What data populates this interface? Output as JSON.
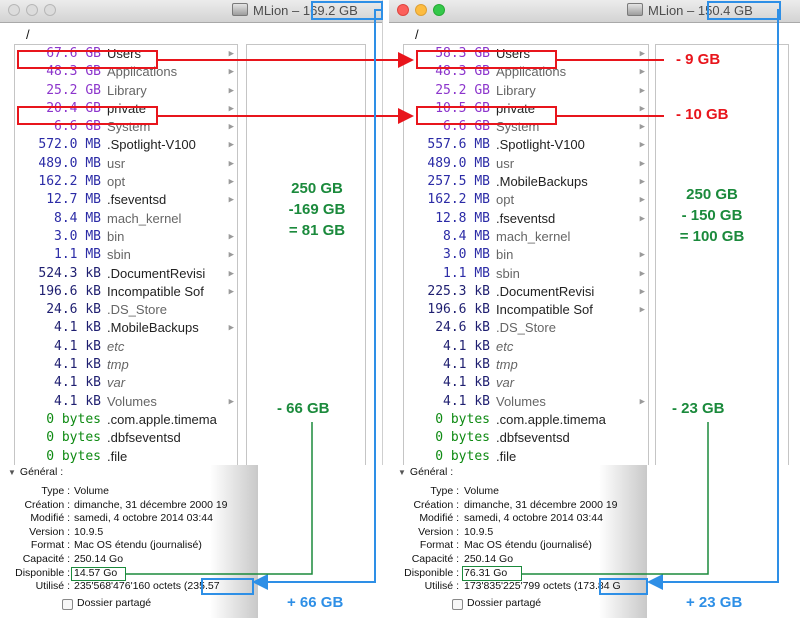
{
  "left_window": {
    "title": "MLion –",
    "title_size": "169.2 GB",
    "path": "/",
    "rows": [
      {
        "size": "67.6 GB",
        "name": "Users",
        "kind": "gb",
        "style": "normal",
        "folder": true
      },
      {
        "size": "48.3 GB",
        "name": "Applications",
        "kind": "gb",
        "style": "dim",
        "folder": true
      },
      {
        "size": "25.2 GB",
        "name": "Library",
        "kind": "gb",
        "style": "dim",
        "folder": true
      },
      {
        "size": "20.4 GB",
        "name": "private",
        "kind": "gb",
        "style": "normal",
        "folder": true
      },
      {
        "size": "6.6 GB",
        "name": "System",
        "kind": "gb",
        "style": "dim",
        "folder": true
      },
      {
        "size": "572.0 MB",
        "name": ".Spotlight-V100",
        "kind": "mb",
        "style": "normal",
        "folder": true
      },
      {
        "size": "489.0 MB",
        "name": "usr",
        "kind": "mb",
        "style": "dim",
        "folder": true
      },
      {
        "size": "162.2 MB",
        "name": "opt",
        "kind": "mb",
        "style": "dim",
        "folder": true
      },
      {
        "size": "12.7 MB",
        "name": ".fseventsd",
        "kind": "mb",
        "style": "normal",
        "folder": true
      },
      {
        "size": "8.4 MB",
        "name": "mach_kernel",
        "kind": "mb",
        "style": "dim",
        "folder": false
      },
      {
        "size": "3.0 MB",
        "name": "bin",
        "kind": "mb",
        "style": "dim",
        "folder": true
      },
      {
        "size": "1.1 MB",
        "name": "sbin",
        "kind": "mb",
        "style": "dim",
        "folder": true
      },
      {
        "size": "524.3 kB",
        "name": ".DocumentRevisi",
        "kind": "kb",
        "style": "normal",
        "folder": true
      },
      {
        "size": "196.6 kB",
        "name": "Incompatible Sof",
        "kind": "kb",
        "style": "normal",
        "folder": true
      },
      {
        "size": "24.6 kB",
        "name": ".DS_Store",
        "kind": "kb",
        "style": "dim",
        "folder": false
      },
      {
        "size": "4.1 kB",
        "name": ".MobileBackups",
        "kind": "kb",
        "style": "normal",
        "folder": true
      },
      {
        "size": "4.1 kB",
        "name": "etc",
        "kind": "kb",
        "style": "it",
        "folder": false
      },
      {
        "size": "4.1 kB",
        "name": "tmp",
        "kind": "kb",
        "style": "it",
        "folder": false
      },
      {
        "size": "4.1 kB",
        "name": "var",
        "kind": "kb",
        "style": "it",
        "folder": false
      },
      {
        "size": "4.1 kB",
        "name": "Volumes",
        "kind": "kb",
        "style": "dim",
        "folder": true
      },
      {
        "size": "0 bytes",
        "name": ".com.apple.timema",
        "kind": "b",
        "style": "normal",
        "folder": false
      },
      {
        "size": "0 bytes",
        "name": ".dbfseventsd",
        "kind": "b",
        "style": "normal",
        "folder": false
      },
      {
        "size": "0 bytes",
        "name": ".file",
        "kind": "b",
        "style": "normal",
        "folder": false
      }
    ]
  },
  "right_window": {
    "title": "MLion –",
    "title_size": "150.4 GB",
    "path": "/",
    "rows": [
      {
        "size": "58.3 GB",
        "name": "Users",
        "kind": "gb",
        "style": "normal",
        "folder": true
      },
      {
        "size": "48.3 GB",
        "name": "Applications",
        "kind": "gb",
        "style": "dim",
        "folder": true
      },
      {
        "size": "25.2 GB",
        "name": "Library",
        "kind": "gb",
        "style": "dim",
        "folder": true
      },
      {
        "size": "10.5 GB",
        "name": "private",
        "kind": "gb",
        "style": "normal",
        "folder": true
      },
      {
        "size": "6.6 GB",
        "name": "System",
        "kind": "gb",
        "style": "dim",
        "folder": true
      },
      {
        "size": "557.6 MB",
        "name": ".Spotlight-V100",
        "kind": "mb",
        "style": "normal",
        "folder": true
      },
      {
        "size": "489.0 MB",
        "name": "usr",
        "kind": "mb",
        "style": "dim",
        "folder": true
      },
      {
        "size": "257.5 MB",
        "name": ".MobileBackups",
        "kind": "mb",
        "style": "normal",
        "folder": true
      },
      {
        "size": "162.2 MB",
        "name": "opt",
        "kind": "mb",
        "style": "dim",
        "folder": true
      },
      {
        "size": "12.8 MB",
        "name": ".fseventsd",
        "kind": "mb",
        "style": "normal",
        "folder": true
      },
      {
        "size": "8.4 MB",
        "name": "mach_kernel",
        "kind": "mb",
        "style": "dim",
        "folder": false
      },
      {
        "size": "3.0 MB",
        "name": "bin",
        "kind": "mb",
        "style": "dim",
        "folder": true
      },
      {
        "size": "1.1 MB",
        "name": "sbin",
        "kind": "mb",
        "style": "dim",
        "folder": true
      },
      {
        "size": "225.3 kB",
        "name": ".DocumentRevisi",
        "kind": "kb",
        "style": "normal",
        "folder": true
      },
      {
        "size": "196.6 kB",
        "name": "Incompatible Sof",
        "kind": "kb",
        "style": "normal",
        "folder": true
      },
      {
        "size": "24.6 kB",
        "name": ".DS_Store",
        "kind": "kb",
        "style": "dim",
        "folder": false
      },
      {
        "size": "4.1 kB",
        "name": "etc",
        "kind": "kb",
        "style": "it",
        "folder": false
      },
      {
        "size": "4.1 kB",
        "name": "tmp",
        "kind": "kb",
        "style": "it",
        "folder": false
      },
      {
        "size": "4.1 kB",
        "name": "var",
        "kind": "kb",
        "style": "it",
        "folder": false
      },
      {
        "size": "4.1 kB",
        "name": "Volumes",
        "kind": "kb",
        "style": "dim",
        "folder": true
      },
      {
        "size": "0 bytes",
        "name": ".com.apple.timema",
        "kind": "b",
        "style": "normal",
        "folder": false
      },
      {
        "size": "0 bytes",
        "name": ".dbfseventsd",
        "kind": "b",
        "style": "normal",
        "folder": false
      },
      {
        "size": "0 bytes",
        "name": ".file",
        "kind": "b",
        "style": "normal",
        "folder": false
      }
    ]
  },
  "left_info": {
    "header": "Général :",
    "rows": [
      {
        "label": "Type :",
        "value": "Volume"
      },
      {
        "label": "Création :",
        "value": "dimanche, 31 décembre 2000 19"
      },
      {
        "label": "Modifié :",
        "value": "samedi, 4 octobre 2014 03:44"
      },
      {
        "label": "Version :",
        "value": "10.9.5"
      },
      {
        "label": "Format :",
        "value": "Mac OS étendu (journalisé)"
      },
      {
        "label": "Capacité :",
        "value": "250.14 Go"
      },
      {
        "label": "Disponible :",
        "value": "14.57 Go"
      },
      {
        "label": "Utilisé :",
        "value": "235'568'476'160 octets (235.57"
      }
    ],
    "shared_folder": "Dossier partagé"
  },
  "right_info": {
    "header": "Général :",
    "rows": [
      {
        "label": "Type :",
        "value": "Volume"
      },
      {
        "label": "Création :",
        "value": "dimanche, 31 décembre 2000 19"
      },
      {
        "label": "Modifié :",
        "value": "samedi, 4 octobre 2014 03:44"
      },
      {
        "label": "Version :",
        "value": "10.9.5"
      },
      {
        "label": "Format :",
        "value": "Mac OS étendu (journalisé)"
      },
      {
        "label": "Capacité :",
        "value": "250.14 Go"
      },
      {
        "label": "Disponible :",
        "value": "76.31 Go"
      },
      {
        "label": "Utilisé :",
        "value": "173'835'225'799 octets (173.84 G"
      }
    ],
    "shared_folder": "Dossier partagé"
  },
  "annotations": {
    "left_calc": [
      "250 GB",
      "-169 GB",
      "= 81 GB"
    ],
    "right_calc": [
      "250 GB",
      "- 150 GB",
      "= 100 GB"
    ],
    "users_diff": "- 9 GB",
    "private_diff": "- 10 GB",
    "left_avail_diff": "- 66 GB",
    "right_avail_diff": "- 23 GB",
    "left_used_diff": "+ 66 GB",
    "right_used_diff": "+ 23 GB"
  },
  "colors": {
    "annotation_red": "#e8151c",
    "annotation_green": "#1b8a3c",
    "annotation_blue": "#2e8fe6",
    "size_gb": "#8c35cc"
  }
}
